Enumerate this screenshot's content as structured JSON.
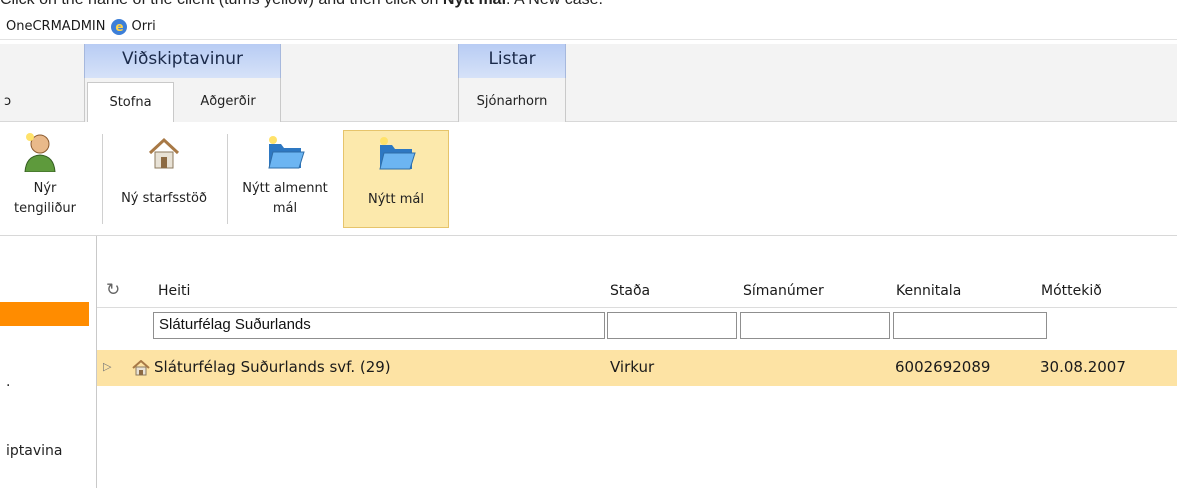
{
  "instruction": {
    "prefix": "Click on the name of the client (turns yellow) and then click on ",
    "bold": "Nýtt mál",
    "suffix": ". A New case."
  },
  "topbar": {
    "item1": "OneCRMADMIN",
    "item2": "Orri"
  },
  "ribbon": {
    "cut_tab": "ɔ",
    "groups": {
      "customer": "Viðskiptavinur",
      "lists": "Listar"
    },
    "subtabs": {
      "create": "Stofna",
      "actions": "Aðgerðir",
      "views": "Sjónarhorn"
    },
    "buttons": {
      "new_contact_line1": "Nýr",
      "new_contact_line2": "tengiliður",
      "new_station": "Ný starfsstöð",
      "new_general_case_line1": "Nýtt almennt",
      "new_general_case_line2": "mál",
      "new_case": "Nýtt mál"
    }
  },
  "sidebar": {
    "item1": ".",
    "item2": "iptavina"
  },
  "table": {
    "columns": {
      "name": "Heiti",
      "status": "Staða",
      "phone": "Símanúmer",
      "ssn": "Kennitala",
      "received": "Móttekið"
    },
    "filter_name_value": "Sláturfélag Suðurlands",
    "rows": [
      {
        "name": "Sláturfélag Suðurlands svf. (29)",
        "status": "Virkur",
        "phone": "",
        "ssn": "6002692089",
        "received": "30.08.2007"
      }
    ]
  },
  "colors": {
    "highlight_row": "#fde3a4",
    "hot_button": "#fce9ac",
    "selected_sidebar": "#ff8c00",
    "group_tab": "#c7d7f5"
  }
}
